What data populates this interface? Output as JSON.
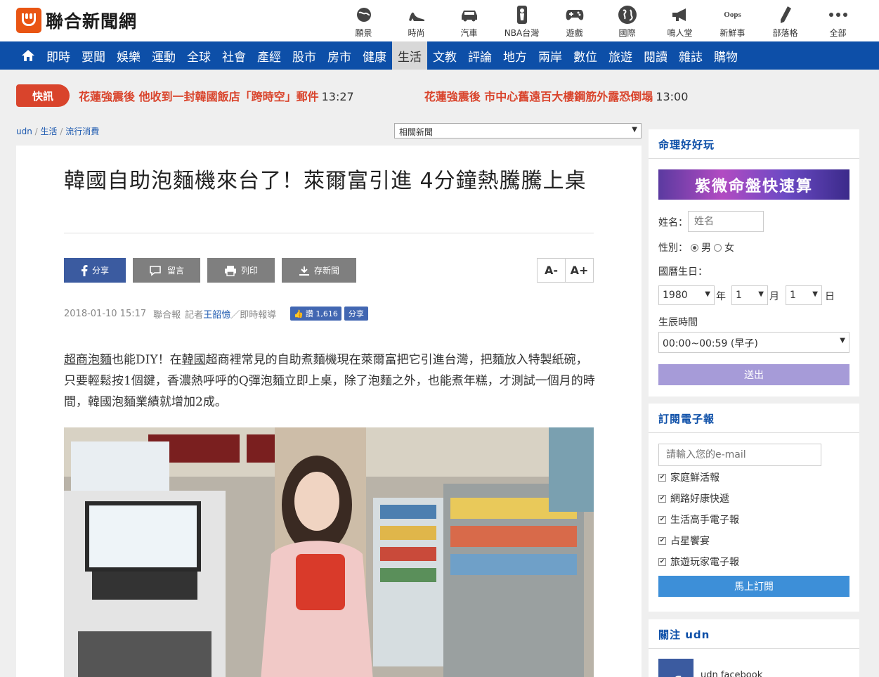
{
  "header": {
    "logo_text": "聯合新聞網",
    "top_nav": [
      {
        "label": "願景",
        "icon": "globe-icon"
      },
      {
        "label": "時尚",
        "icon": "high-heel-icon"
      },
      {
        "label": "汽車",
        "icon": "car-icon"
      },
      {
        "label": "NBA台灣",
        "icon": "nba-icon"
      },
      {
        "label": "遊戲",
        "icon": "gamepad-icon"
      },
      {
        "label": "國際",
        "icon": "world-icon"
      },
      {
        "label": "鳴人堂",
        "icon": "megaphone-icon"
      },
      {
        "label": "新鮮事",
        "icon": "oops-icon",
        "icon_text": "Oops"
      },
      {
        "label": "部落格",
        "icon": "pen-icon"
      },
      {
        "label": "全部",
        "icon": "more-dots-icon"
      }
    ]
  },
  "main_nav": {
    "items": [
      "即時",
      "要聞",
      "娛樂",
      "運動",
      "全球",
      "社會",
      "產經",
      "股市",
      "房市",
      "健康",
      "生活",
      "文教",
      "評論",
      "地方",
      "兩岸",
      "數位",
      "旅遊",
      "閱讀",
      "雜誌",
      "購物"
    ],
    "active": "生活"
  },
  "breaking": {
    "badge": "快訊",
    "items": [
      {
        "text": "花蓮強震後 他收到一封韓國飯店「跨時空」郵件",
        "time": "13:27"
      },
      {
        "text": "花蓮強震後 市中心舊遠百大樓鋼筋外露恐倒塌",
        "time": "13:00"
      }
    ]
  },
  "breadcrumb": {
    "items": [
      "udn",
      "生活",
      "流行消費"
    ],
    "sep": "/"
  },
  "related_select": "相關新聞",
  "article": {
    "headline": "韓國自助泡麵機來台了！萊爾富引進 4分鐘熱騰騰上桌",
    "tools": {
      "share": "分享",
      "comment": "留言",
      "print": "列印",
      "save": "存新聞",
      "font_minus": "A-",
      "font_plus": "A+"
    },
    "meta": {
      "datetime": "2018-01-10 15:17",
      "source": "聯合報",
      "reporter_prefix": "記者",
      "reporter": "王韶憶",
      "suffix": "／即時報導"
    },
    "fb_like": {
      "label": "讚",
      "count": "1,616"
    },
    "fb_share": "分享",
    "body_links": [
      "超商泡麵",
      "韓國"
    ],
    "body_parts": [
      "也能DIY！在",
      "超商裡常見的自助煮麵機現在萊爾富把它引進台灣，把麵放入特製紙碗，只要輕鬆按1個鍵，香濃熱呼呼的Q彈泡麵立即上桌，除了泡麵之外，也能煮年糕，才測試一個月的時間，韓國泡麵業績就增加2成。"
    ]
  },
  "sidebar": {
    "fortune": {
      "title": "命理好好玩",
      "banner": "紫微命盤快速算",
      "name_label": "姓名：",
      "name_placeholder": "姓名",
      "gender_label": "性別：",
      "gender_male": "男",
      "gender_female": "女",
      "birth_label": "國曆生日：",
      "year": "1980",
      "year_unit": "年",
      "month": "1",
      "month_unit": "月",
      "day": "1",
      "day_unit": "日",
      "hour_label": "生辰時間",
      "hour_value": "00:00~00:59 (早子)",
      "submit": "送出"
    },
    "newsletter": {
      "title": "訂閱電子報",
      "email_placeholder": "請輸入您的e-mail",
      "items": [
        "家庭鮮活報",
        "網路好康快遞",
        "生活高手電子報",
        "占星饗宴",
        "旅遊玩家電子報"
      ],
      "submit": "馬上訂閱"
    },
    "follow": {
      "title": "關注 udn",
      "facebook": "udn facebook"
    }
  },
  "colors": {
    "brand_blue": "#0d4fa8",
    "logo_orange": "#e95513",
    "breaking_red": "#d9442c",
    "facebook": "#3b5ba0"
  }
}
